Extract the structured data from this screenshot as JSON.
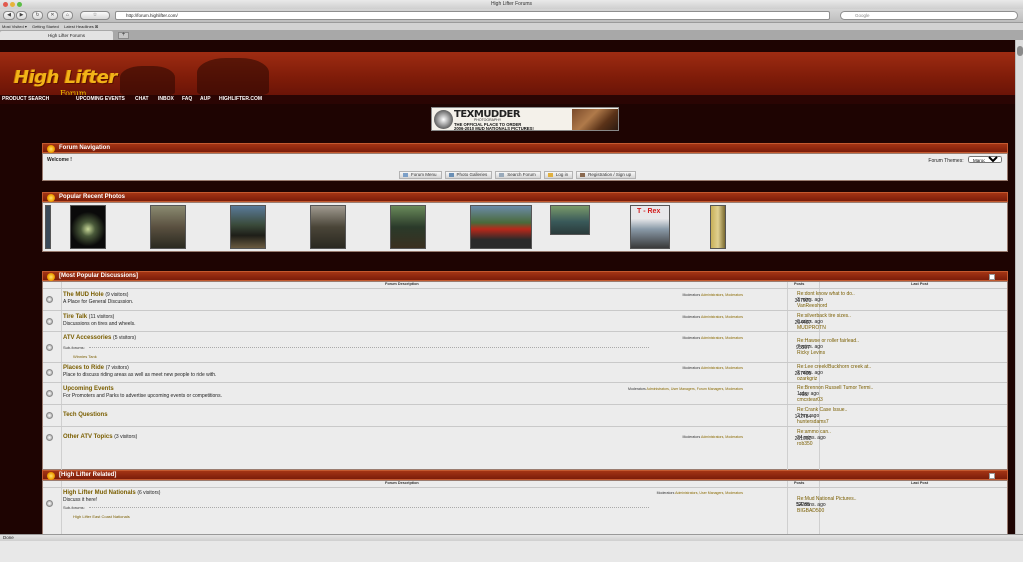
{
  "window": {
    "title": "High Lifter Forums"
  },
  "browser": {
    "url": "http://forum.highlifter.com/",
    "search_placeholder": "Google",
    "bookmarks": [
      "Most Visited ▾",
      "Getting Started",
      "Latest Headlines ⊠"
    ],
    "tab_title": "High Lifter Forums",
    "new_tab": "+",
    "status": "Done"
  },
  "colors": {
    "accent": "#a43414",
    "link": "#7a5e00",
    "page_bg": "#1e0402",
    "gold": "#f2b318"
  },
  "site": {
    "logo": "High Lifter",
    "logo_sub": "Forum",
    "nav": [
      "PRODUCT SEARCH",
      "UPCOMING EVENTS",
      "CHAT",
      "INBOX",
      "FAQ",
      "AUP",
      "HIGHLIFTER.COM"
    ]
  },
  "banner": {
    "brand": "TEXMUDDER",
    "brand_sub": "PHOTOGRAPHY",
    "line1": "THE OFFICIAL PLACE TO ORDER",
    "line2": "2006-2010 MUD NATIONALS PICTURES!"
  },
  "forum_nav": {
    "title": "Forum Navigation",
    "welcome": "Welcome !",
    "themes_label": "Forum Themes:",
    "theme_selected": "Maroon",
    "links": [
      "Forum Menu",
      "Photo Galleries",
      "Search Forum",
      "Log in",
      "Registration / Sign up"
    ]
  },
  "photos": {
    "title": "Popular Recent Photos",
    "rex_label": "T - Rex"
  },
  "mark_read": "Mark All Forums Read",
  "popular": {
    "title": "[Most Popular Discussions]",
    "col_desc": "Forum Description",
    "col_posts": "Posts",
    "col_last": "Last Post",
    "forums": [
      {
        "title": "The MUD Hole",
        "visitors": "(9 visitors)",
        "desc": "A Place for General Discussion.",
        "mods_label": "Moderators",
        "mods": "Administrators, Moderators",
        "posts": "367921",
        "last_title": "Re:dont know what to do..",
        "last_time": "3 mins. ago",
        "last_user": "VanReeshord"
      },
      {
        "title": "Tire Talk",
        "visitors": "(11 visitors)",
        "desc": "Discussions on tires and wheels.",
        "mods_label": "Moderators",
        "mods": "Administrators, Moderators",
        "posts": "264467",
        "last_title": "Re:silverback tire sizes..",
        "last_time": "0 mins. ago",
        "last_user": "MUDPROTN"
      },
      {
        "title": "ATV Accessories",
        "visitors": "(5 visitors)",
        "desc": "",
        "subforums": "Sub-forums:",
        "sublink": "Winnies Tank",
        "mods_label": "Moderators",
        "mods": "Administrators, Moderators",
        "posts": "95597",
        "last_title": "Re:Hawse or roller fairlead..",
        "last_time": "7 mins. ago",
        "last_user": "Ricky Levins"
      },
      {
        "title": "Places to Ride",
        "visitors": "(7 visitors)",
        "desc": "Place to discuss riding areas as well as meet new people to ride with.",
        "mods_label": "Moderators",
        "mods": "Administrators, Moderators",
        "posts": "257405",
        "last_title": "Re:Lee creek/Buckhorn creek at..",
        "last_time": "2 mins. ago",
        "last_user": "ozarkgriz"
      },
      {
        "title": "Upcoming Events",
        "visitors": "",
        "desc": "For Promoters and Parks to advertise upcoming events or competitions.",
        "mods_label": "Moderators",
        "mods": "Administrators, User Managers, Forum Managers, Moderators",
        "posts": "465",
        "last_title": "Re:Brennon Russell Tumor Termi..",
        "last_time": "1 day ago",
        "last_user": "cmcstear03"
      },
      {
        "title": "Tech Questions",
        "visitors": "",
        "desc": "",
        "mods_label": "",
        "mods": "",
        "posts": "142784",
        "last_title": "Re:Crank Case Issue..",
        "last_time": "2 hrs. ago",
        "last_user": "huntersdams7"
      },
      {
        "title": "Other ATV Topics",
        "visitors": "(3 visitors)",
        "desc": "",
        "mods_label": "Moderators",
        "mods": "Administrators, Moderators",
        "posts": "201062",
        "last_title": "Re:ammo can..",
        "last_time": "24 mins. ago",
        "last_user": "rob350"
      }
    ]
  },
  "related": {
    "title": "[High Lifter Related]",
    "col_desc": "Forum Description",
    "col_posts": "Posts",
    "col_last": "Last Post",
    "forums": [
      {
        "title": "High Lifter Mud Nationals",
        "visitors": "(6 visitors)",
        "desc": "Discuss it here!",
        "subforums": "Sub-forums:",
        "sublink": "High Lifter East Coast Nationals",
        "mods_label": "Moderators",
        "mods": "Administrators, User Managers, Moderators",
        "posts": "52285",
        "last_title": "Re:Mud National Pictures..",
        "last_time": "54 mins. ago",
        "last_user": "BIGBAD500"
      }
    ]
  }
}
